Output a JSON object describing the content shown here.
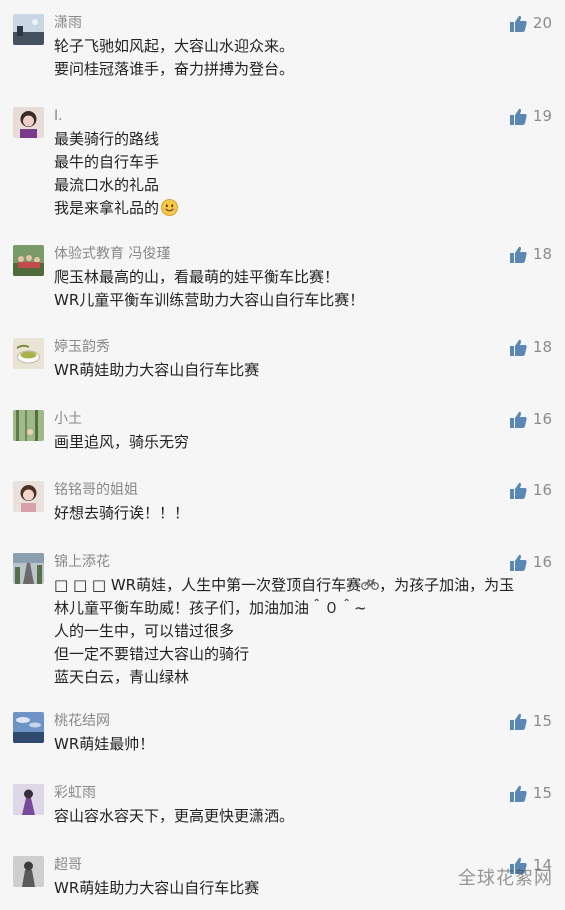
{
  "comments": [
    {
      "nickname": "潇雨",
      "likes": "20",
      "avatar": "avatar-landscape",
      "lines": [
        "轮子飞驰如风起，大容山水迎众来。",
        "要问桂冠落谁手，奋力拼搏为登台。"
      ]
    },
    {
      "nickname": "I.",
      "likes": "19",
      "avatar": "avatar-portrait",
      "lines": [
        "最美骑行的路线",
        "最牛的自行车手",
        "最流口水的礼品",
        "我是来拿礼品的"
      ]
    },
    {
      "nickname": "体验式教育 冯俊瑾",
      "likes": "18",
      "avatar": "avatar-group-photo",
      "lines": [
        "爬玉林最高的山，看最萌的娃平衡车比赛！",
        "WR儿童平衡车训练营助力大容山自行车比赛！"
      ]
    },
    {
      "nickname": "婷玉韵秀",
      "likes": "18",
      "avatar": "avatar-tea-cup",
      "lines": [
        "WR萌娃助力大容山自行车比赛"
      ]
    },
    {
      "nickname": "小土",
      "likes": "16",
      "avatar": "avatar-forest",
      "lines": [
        "画里追风，骑乐无穷"
      ]
    },
    {
      "nickname": "铭铭哥的姐姐",
      "likes": "16",
      "avatar": "avatar-girl",
      "lines": [
        "好想去骑行诶！！！"
      ]
    },
    {
      "nickname": "锦上添花",
      "likes": "16",
      "avatar": "avatar-road",
      "lines": [
        "□ □ □ WR萌娃，人生中第一次登顶自行车赛",
        "，为孩子加油，为玉",
        "林儿童平衡车助威！孩子们，加油加油＾０＾~",
        "人的一生中，可以错过很多",
        "但一定不要错过大容山的骑行",
        "蓝天白云，青山绿林"
      ]
    },
    {
      "nickname": "桃花结网",
      "likes": "15",
      "avatar": "avatar-sky",
      "lines": [
        "WR萌娃最帅！"
      ]
    },
    {
      "nickname": "彩虹雨",
      "likes": "15",
      "avatar": "avatar-purple-figure",
      "lines": [
        "容山容水容天下，更高更快更潇洒。"
      ]
    },
    {
      "nickname": "超哥",
      "likes": "14",
      "avatar": "avatar-grey-figure",
      "lines": [
        "WR萌娃助力大容山自行车比赛"
      ]
    }
  ],
  "watermark": "全球花絮网",
  "colors": {
    "background": "#f6f6f6",
    "nickname": "#888888",
    "text": "#222222",
    "like_icon": "#5b87b5",
    "like_count": "#8c8c8c"
  },
  "icons": {
    "like": "thumbs-up-icon",
    "smiley": "smiley-face-icon",
    "bike": "bicycle-icon"
  }
}
